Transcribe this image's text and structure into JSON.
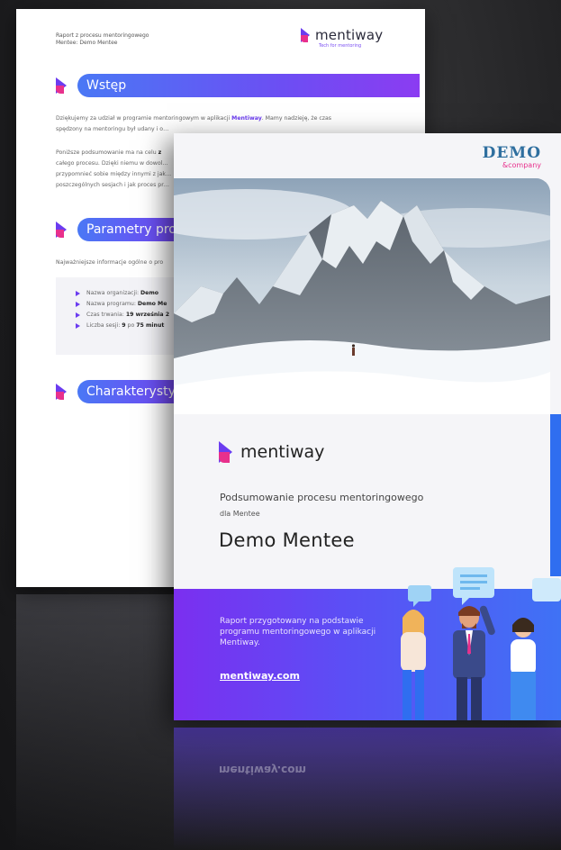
{
  "back_page": {
    "header_line1": "Raport z procesu mentoringowego",
    "header_line2": "Mentee: Demo Mentee",
    "logo_word": "mentiway",
    "logo_tagline": "Tech for mentoring",
    "section1_title": "Wstęp",
    "intro_p1_a": "Dziękujemy za udział w programie mentoringowym w aplikacji ",
    "intro_p1_brand": "Mentiway",
    "intro_p1_b": ". Mamy nadzieję, że czas",
    "intro_p1_line2": "spędzony na mentoringu był udany i o…",
    "intro_p2_line1_a": "Poniższe podsumowanie ma na celu ",
    "intro_p2_line1_b": "z",
    "intro_p2_line2": "całego procesu. Dzięki niemu w dowol…",
    "intro_p2_line3": "przypomnieć sobie między innymi z jak…",
    "intro_p2_line4": "poszczególnych sesjach i jak proces pr…",
    "section2_title": "Parametry prog",
    "params_intro": "Najważniejsze informacje ogólne o pro",
    "params": [
      {
        "label": "Nazwa organizacji: ",
        "value": "Demo"
      },
      {
        "label": "Nazwa programu: ",
        "value": "Demo Me"
      },
      {
        "label": "Czas trwania: ",
        "value": "19 września 2"
      },
      {
        "label": "Liczba sesji: ",
        "value": "9",
        "suffix": " po ",
        "value2": "75 minut"
      }
    ],
    "section3_title": "Charakterystyk"
  },
  "front_page": {
    "partner_logo_line1": "DEMO",
    "partner_logo_line2": "&company",
    "logo_word": "mentiway",
    "subtitle": "Podsumowanie procesu mentoringowego",
    "subtitle2": "dla Mentee",
    "name": "Demo Mentee",
    "band_text": "Raport przygotowany na podstawie programu mentoringowego w aplikacji Mentiway.",
    "link": "mentiway.com"
  },
  "colors": {
    "brand_purple": "#6b3cf0",
    "brand_pink": "#e8308c",
    "band_start": "#7b2ff0",
    "band_end": "#3f72f5",
    "partner_blue": "#2f6f9f"
  }
}
